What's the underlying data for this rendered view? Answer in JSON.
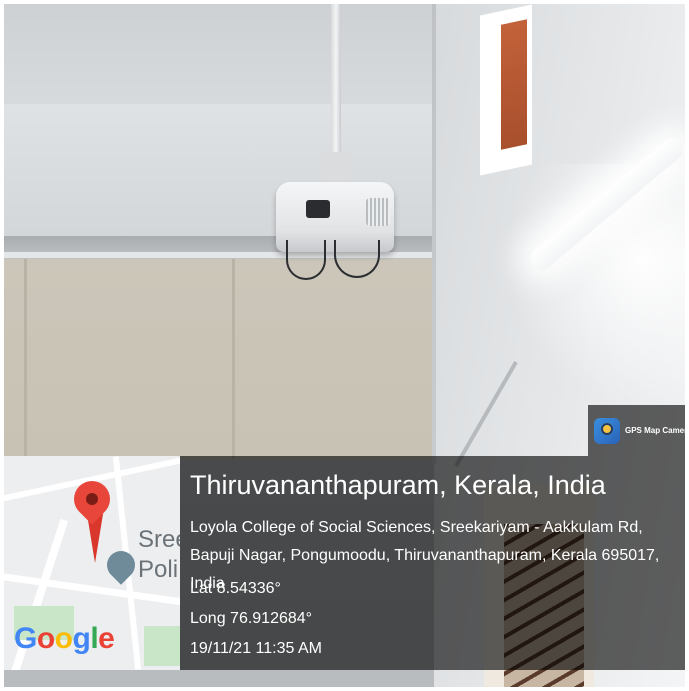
{
  "badge": {
    "label": "GPS Map Camera",
    "icon": "gps-map-camera-app-icon"
  },
  "map": {
    "place_label_line1": "Sree",
    "place_label_line2": "Poli",
    "logo_text": "Google",
    "logo_colors": [
      "#4285F4",
      "#EA4335",
      "#FBBC05",
      "#4285F4",
      "#34A853",
      "#EA4335"
    ],
    "pin_color": "#E8463A",
    "pin_icon": "map-pin-icon",
    "poi_icon": "police-station-icon"
  },
  "location": {
    "title": "Thiruvananthapuram, Kerala, India",
    "address": "Loyola College of Social Sciences, Sreekariyam - Aakkulam Rd, Bapuji Nagar, Pongumoodu, Thiruvananthapuram, Kerala 695017, India",
    "lat": "Lat 8.54336°",
    "long": "Long 76.912684°",
    "timestamp": "19/11/21 11:35 AM"
  }
}
